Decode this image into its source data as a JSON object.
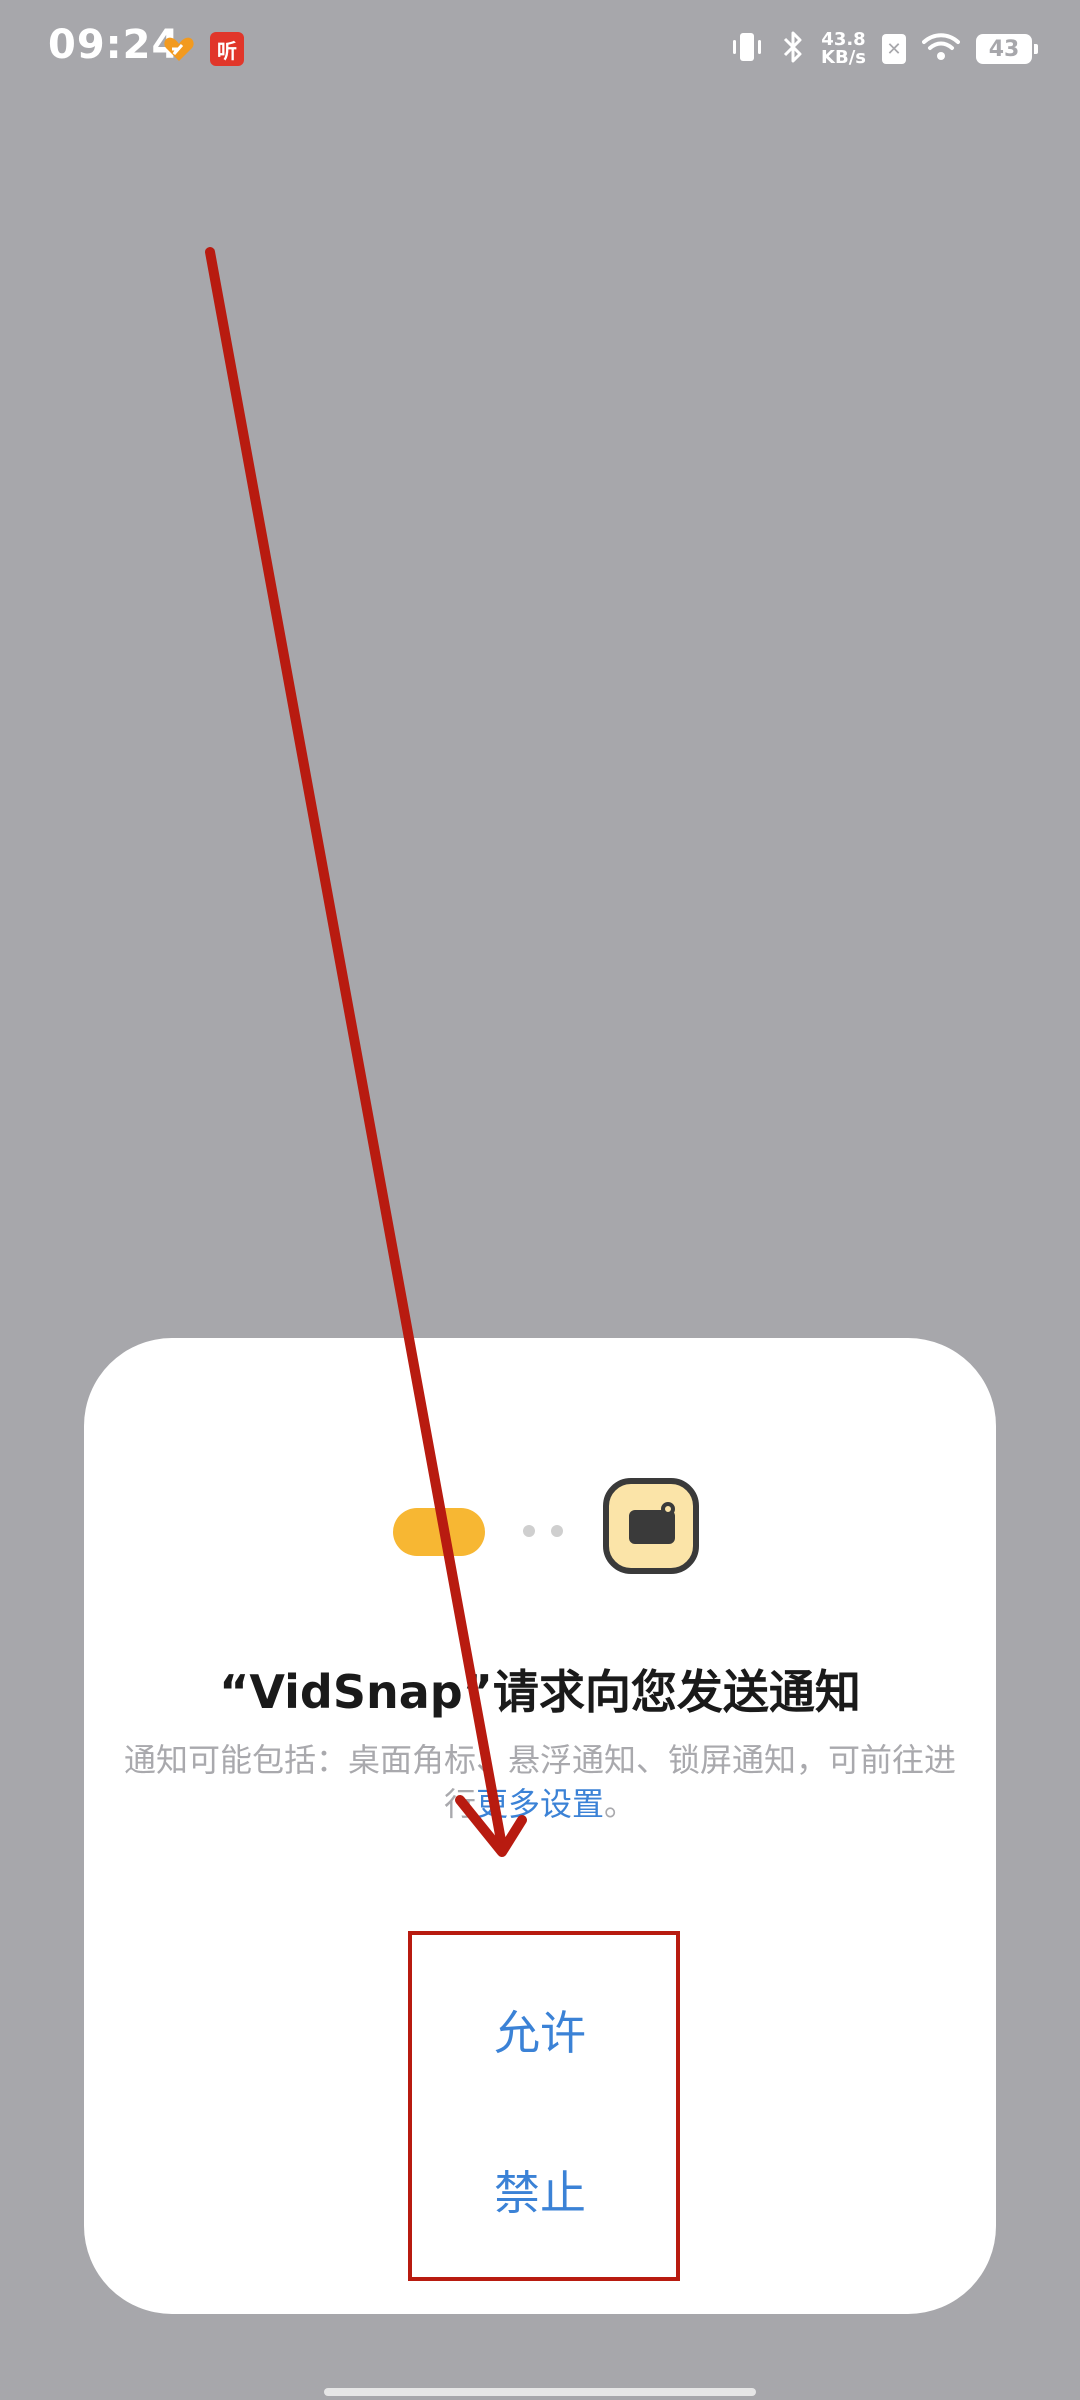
{
  "status_bar": {
    "time": "09:24",
    "app_badge_label": "听",
    "net_speed_value": "43.8",
    "net_speed_unit": "KB/s",
    "battery_level": "43",
    "icons": [
      "heart-app-icon",
      "listen-app-icon",
      "vibrate-icon",
      "bluetooth-icon",
      "sim-off-icon",
      "wifi-icon",
      "battery-icon"
    ]
  },
  "dialog": {
    "title": "“VidSnap”请求向您发送通知",
    "description_prefix": "通知可能包括：桌面角标、悬浮通知、锁屏通知，可前往进行",
    "description_link": "更多设置",
    "description_suffix": "。",
    "allow_label": "允许",
    "deny_label": "禁止"
  },
  "colors": {
    "background_dim": "#a7a7ab",
    "accent_blue": "#3b82d6",
    "annotation_red": "#b81b10",
    "pill_yellow": "#f7b733"
  }
}
